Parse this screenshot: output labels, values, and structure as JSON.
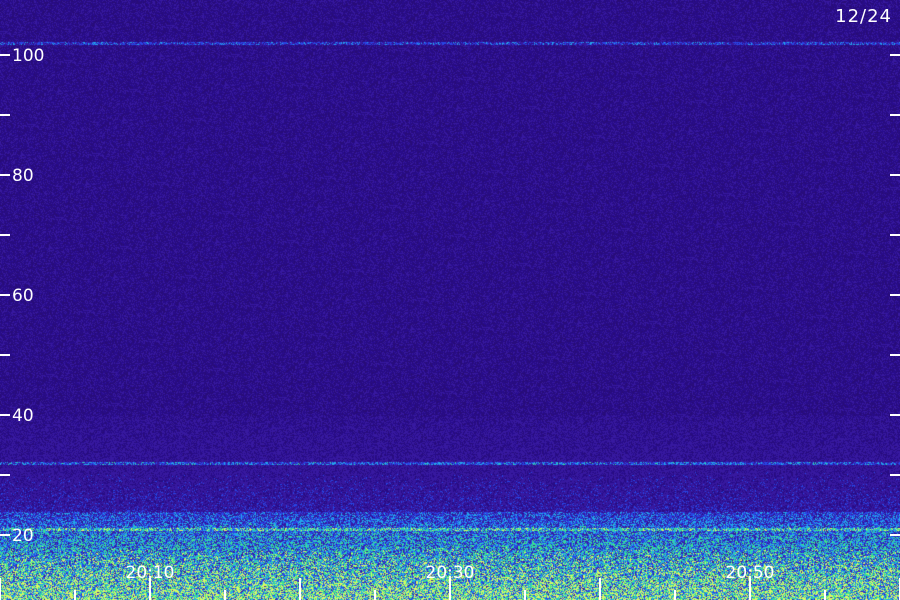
{
  "chart_data": {
    "type": "heatmap",
    "date_label": "12/24",
    "y_tick_labels": [
      100,
      80,
      60,
      40,
      20
    ],
    "y_minor_ticks": [
      90,
      70,
      50,
      30
    ],
    "ylim": [
      15,
      107
    ],
    "x_tick_labels": [
      "20:10",
      "20:30",
      "20:50"
    ],
    "xlim_minutes": [
      20.0,
      60.0
    ],
    "x_tick_values_minutes": [
      30,
      50,
      70
    ],
    "notable_lines_y": [
      102,
      32,
      21
    ],
    "colormap": [
      "#2a0f6a",
      "#3d1fa0",
      "#2b4ef0",
      "#22b8f0",
      "#3df080",
      "#e8ff60"
    ]
  }
}
